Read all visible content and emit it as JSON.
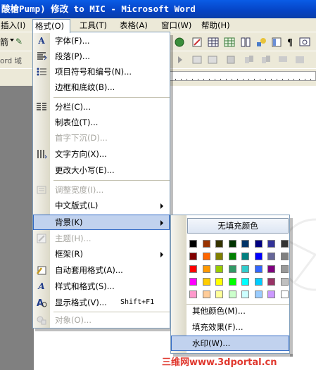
{
  "title": "酸槍Pump) 修改 to MIC - Microsoft Word",
  "menubar": {
    "items": [
      {
        "label": "插入(I)"
      },
      {
        "label": "格式(O)"
      },
      {
        "label": "工具(T)"
      },
      {
        "label": "表格(A)"
      },
      {
        "label": "窗口(W)"
      },
      {
        "label": "帮助(H)"
      }
    ]
  },
  "toolbar": {
    "style_label": "箭",
    "word_field_label": "ord 域"
  },
  "format_menu": {
    "items": [
      {
        "label": "字体(F)...",
        "icon": "font-icon",
        "disabled": false
      },
      {
        "label": "段落(P)...",
        "icon": "paragraph-icon",
        "disabled": false
      },
      {
        "label": "项目符号和编号(N)...",
        "icon": "bullets-icon",
        "disabled": false
      },
      {
        "label": "边框和底纹(B)...",
        "icon": "",
        "disabled": false
      },
      {
        "label": "分栏(C)...",
        "icon": "columns-icon",
        "disabled": false
      },
      {
        "label": "制表位(T)...",
        "icon": "",
        "disabled": false
      },
      {
        "label": "首字下沉(D)...",
        "icon": "",
        "disabled": true
      },
      {
        "label": "文字方向(X)...",
        "icon": "text-direction-icon",
        "disabled": false
      },
      {
        "label": "更改大小写(E)...",
        "icon": "",
        "disabled": false
      },
      {
        "label": "调整宽度(I)...",
        "icon": "fit-width-icon",
        "disabled": true
      },
      {
        "label": "中文版式(L)",
        "icon": "",
        "disabled": false,
        "submenu": true
      },
      {
        "label": "背景(K)",
        "icon": "",
        "disabled": false,
        "submenu": true,
        "highlighted": true
      },
      {
        "label": "主题(H)...",
        "icon": "theme-icon",
        "disabled": true
      },
      {
        "label": "框架(R)",
        "icon": "",
        "disabled": false,
        "submenu": true
      },
      {
        "label": "自动套用格式(A)...",
        "icon": "autoformat-icon",
        "disabled": false
      },
      {
        "label": "样式和格式(S)...",
        "icon": "styles-icon",
        "disabled": false
      },
      {
        "label": "显示格式(V)...",
        "icon": "reveal-formatting-icon",
        "disabled": false,
        "shortcut": "Shift+F1"
      },
      {
        "label": "对象(O)...",
        "icon": "object-icon",
        "disabled": true
      }
    ]
  },
  "background_submenu": {
    "no_fill": "无填充颜色",
    "colors": [
      [
        "#000000",
        "#993300",
        "#333300",
        "#003300",
        "#003366",
        "#000080",
        "#333399",
        "#333333"
      ],
      [
        "#800000",
        "#FF6600",
        "#808000",
        "#008000",
        "#008080",
        "#0000FF",
        "#666699",
        "#808080"
      ],
      [
        "#FF0000",
        "#FF9900",
        "#99CC00",
        "#339966",
        "#33CCCC",
        "#3366FF",
        "#800080",
        "#999999"
      ],
      [
        "#FF00FF",
        "#FFCC00",
        "#FFFF00",
        "#00FF00",
        "#00FFFF",
        "#00CCFF",
        "#993366",
        "#C0C0C0"
      ],
      [
        "#FF99CC",
        "#FFCC99",
        "#FFFF99",
        "#CCFFCC",
        "#CCFFFF",
        "#99CCFF",
        "#CC99FF",
        "#FFFFFF"
      ]
    ],
    "items": [
      {
        "label": "其他颜色(M)..."
      },
      {
        "label": "填充效果(F)..."
      },
      {
        "label": "水印(W)...",
        "highlighted": true
      }
    ]
  },
  "watermark_text": "三维网www.3dportal.cn"
}
